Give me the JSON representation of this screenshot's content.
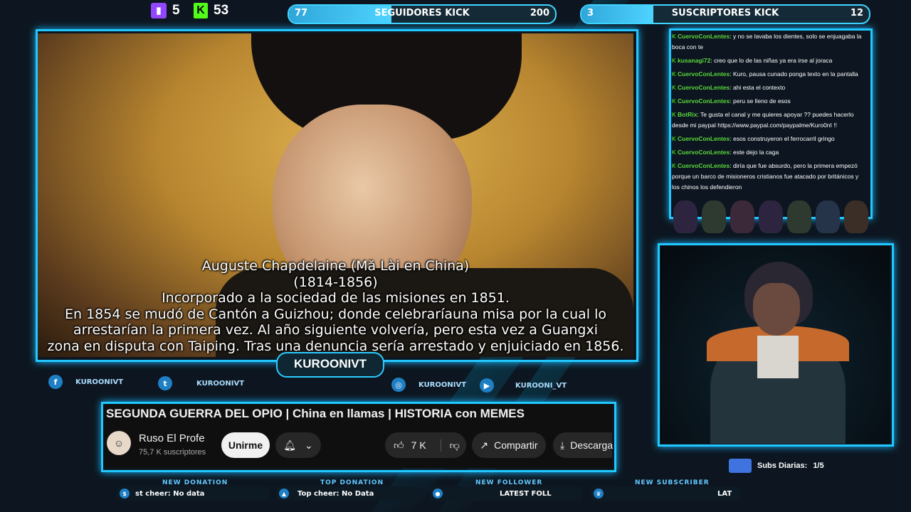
{
  "stream_counts": {
    "twitch_icon": "twitch-icon",
    "twitch_count": "5",
    "kick_icon": "kick-icon",
    "kick_count": "53"
  },
  "goals": [
    {
      "current": "77",
      "label": "SEGUIDORES KICK",
      "target": "200",
      "progress": 0.385
    },
    {
      "current": "3",
      "label": "SUSCRIPTORES KICK",
      "target": "12",
      "progress": 0.25
    }
  ],
  "video": {
    "caption": [
      "Auguste Chapdelaine (Mă Lài en China)",
      "(1814-1856)",
      "Incorporado a la sociedad de las misiones en 1851.",
      "En 1854 se mudó de Cantón a Guizhou; donde celebraríauna misa por la cual lo",
      "arrestarían la primera vez. Al año siguiente volvería, pero esta vez a Guangxi",
      "zona en disputa con Taiping. Tras una denuncia sería arrestado y enjuiciado en 1856."
    ]
  },
  "streamer_name": "KUROONIVT",
  "socials": [
    {
      "icon": "facebook-icon",
      "glyph": "f",
      "handle": "KUROONIVT"
    },
    {
      "icon": "twitter-icon",
      "glyph": "t",
      "handle": "KUROONIVT"
    },
    {
      "icon": "instagram-icon",
      "glyph": "◎",
      "handle": "KUROONIVT"
    },
    {
      "icon": "youtube-icon",
      "glyph": "▶",
      "handle": "KUROONI_VT"
    }
  ],
  "youtube": {
    "title": "SEGUNDA GUERRA DEL OPIO | China en llamas | HISTORIA con MEMES",
    "channel": "Ruso El Profe",
    "subscribers": "75,7 K suscriptores",
    "subscribe_label": "Unirme",
    "likes": "7 K",
    "share_label": "Compartir",
    "download_label": "Descarga"
  },
  "alerts": [
    {
      "title": "NEW DONATION",
      "icon": "donation-icon",
      "text": "st cheer: No data"
    },
    {
      "title": "TOP DONATION",
      "icon": "cheer-icon",
      "text": "Top cheer: No Data"
    },
    {
      "title": "NEW FOLLOWER",
      "icon": "follower-icon",
      "text": "LATEST FOLL"
    },
    {
      "title": "NEW SUBSCRIBER",
      "icon": "subscriber-icon",
      "text": "LAT"
    }
  ],
  "chat": [
    {
      "user": "CuervoConLentes",
      "text": ": y no se lavaba los dientes, solo se enjuagaba la boca con te"
    },
    {
      "user": "kusanagi72",
      "text": ": creo que lo de las niñas ya era irse al joraca"
    },
    {
      "user": "CuervoConLentes",
      "text": ": Kuro, pausa cunado ponga texto en la pantalla"
    },
    {
      "user": "CuervoConLentes",
      "text": ": ahi esta el contexto"
    },
    {
      "user": "CuervoConLentes",
      "text": ": peru se lleno de esos"
    },
    {
      "user": "BotRix",
      "text": ": Te gusta el canal y me quieres apoyar ?? puedes hacerlo desde mi paypal https://www.paypal.com/paypalme/Kuro0nI !!"
    },
    {
      "user": "CuervoConLentes",
      "text": ": esos construyeron el ferrocarril gringo"
    },
    {
      "user": "CuervoConLentes",
      "text": ": este dejo la caga"
    },
    {
      "user": "CuervoConLentes",
      "text": ": diría que fue absurdo, pero la primera empezó porque un barco de misioneros cristianos fue atacado por británicos y los chinos los defendieron"
    }
  ],
  "subs_diarias": {
    "label": "Subs Diarias:",
    "value": "1/5"
  }
}
